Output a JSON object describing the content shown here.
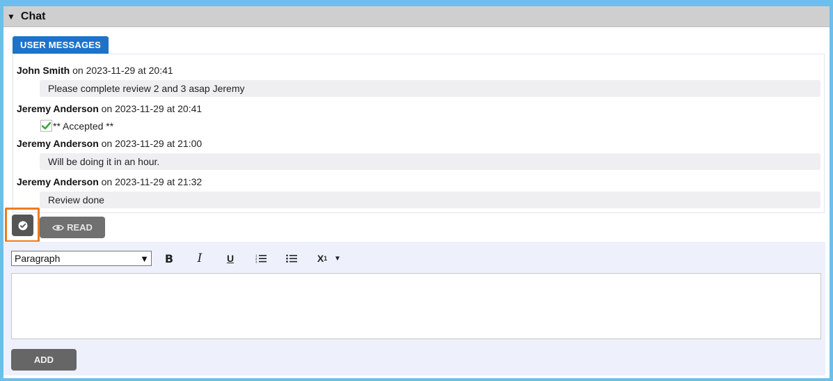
{
  "panel": {
    "toggle_glyph": "▼",
    "title": "Chat"
  },
  "tabs": [
    {
      "label": "USER MESSAGES",
      "active": true
    }
  ],
  "messages": [
    {
      "author": "John Smith",
      "meta": " on 2023-11-29 at 20:41",
      "body": "Please complete review 2 and 3 asap Jeremy"
    },
    {
      "author": "Jeremy Anderson",
      "meta": " on 2023-11-29 at 20:41",
      "body": "** Accepted **",
      "type": "accepted"
    },
    {
      "author": "Jeremy Anderson",
      "meta": " on 2023-11-29 at 21:00",
      "body": "Will be doing it in an hour."
    },
    {
      "author": "Jeremy Anderson",
      "meta": " on 2023-11-29 at 21:32",
      "body": "Review done"
    }
  ],
  "actions": {
    "accept_icon": "check-circle-icon",
    "read_label": "READ",
    "read_icon": "eye-icon"
  },
  "editor": {
    "format_select": {
      "value": "Paragraph",
      "options": [
        "Paragraph"
      ]
    },
    "bold_label": "B",
    "italic_label": "I",
    "underline_label": "U",
    "subscript_label": "X",
    "subscript_index": "1",
    "add_label": "ADD"
  },
  "colors": {
    "accent": "#1e73c8",
    "highlight_border": "#f07c1a",
    "header_bg": "#cfcfcf",
    "editor_bg": "#eef1fc",
    "check_green": "#3aaa35"
  }
}
